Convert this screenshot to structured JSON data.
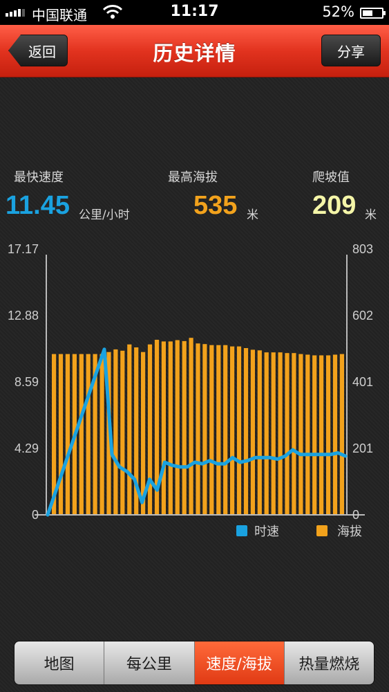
{
  "status_bar": {
    "carrier": "中国联通",
    "time": "11:17",
    "battery": "52%"
  },
  "nav": {
    "title": "历史详情",
    "back_label": "返回",
    "share_label": "分享"
  },
  "stats": [
    {
      "label": "最快速度",
      "value": "11.45",
      "unit": "公里/小时",
      "color": "#1aa2e0"
    },
    {
      "label": "最高海拔",
      "value": "535",
      "unit": "米",
      "color": "#f2a21c"
    },
    {
      "label": "爬坡值",
      "value": "209",
      "unit": "米",
      "color": "#f4f5a8"
    }
  ],
  "chart_data": {
    "type": "bar+line",
    "left_axis": {
      "ticks": [
        "17.17",
        "12.88",
        "8.59",
        "4.29",
        "0"
      ],
      "range": [
        0,
        17.17
      ]
    },
    "right_axis": {
      "ticks": [
        "803",
        "602",
        "401",
        "201",
        "0"
      ],
      "range": [
        0,
        803
      ]
    },
    "legend": [
      {
        "name": "时速",
        "color": "#1aa2e0"
      },
      {
        "name": "海拔",
        "color": "#f2a21c"
      }
    ],
    "elevation": [
      486,
      486,
      486,
      486,
      486,
      486,
      486,
      486,
      492,
      500,
      496,
      515,
      506,
      492,
      515,
      529,
      524,
      524,
      528,
      525,
      535,
      518,
      516,
      513,
      513,
      513,
      509,
      509,
      504,
      499,
      497,
      491,
      491,
      491,
      489,
      489,
      486,
      484,
      482,
      482,
      482,
      484,
      486
    ],
    "speed": [
      0,
      10.7,
      3.9,
      3.1,
      2.8,
      2.3,
      0.8,
      2.3,
      1.6,
      3.4,
      3.2,
      3.1,
      3.1,
      3.4,
      3.3,
      3.5,
      3.3,
      3.3,
      3.7,
      3.4,
      3.5,
      3.7,
      3.7,
      3.7,
      3.6,
      3.8,
      4.2,
      3.9,
      3.9,
      3.9,
      3.9,
      3.9,
      4.0,
      3.8
    ]
  },
  "tabs": [
    {
      "label": "地图",
      "active": false
    },
    {
      "label": "每公里",
      "active": false
    },
    {
      "label": "速度/海拔",
      "active": true
    },
    {
      "label": "热量燃烧",
      "active": false
    }
  ]
}
